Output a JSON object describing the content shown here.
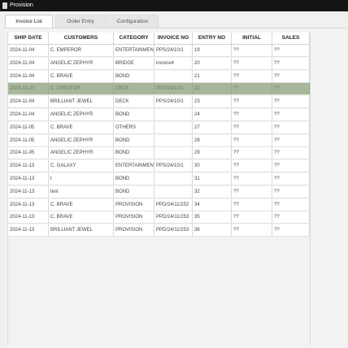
{
  "window": {
    "title": "Provision"
  },
  "tabs": [
    "Invoice List",
    "Order Entry",
    "Configuration"
  ],
  "table": {
    "columns": [
      "SHIP DATE",
      "CUSTOMERS",
      "CATEGORY",
      "INVOICE NO",
      "ENTRY NO",
      "INITIAL",
      "SALES"
    ],
    "rows": [
      [
        "2024-11-04",
        "C. EMPEROR",
        "ENTERTAINMENT",
        "PPS/24/10/1",
        "19",
        "??",
        "??"
      ],
      [
        "2024-11-04",
        "ANGELIC ZEPHYR",
        "BRIDGE",
        "invoice4",
        "20",
        "??",
        "??"
      ],
      [
        "2024-11-04",
        "C. BRAVE",
        "BOND",
        "",
        "21",
        "??",
        "??"
      ],
      [
        "2024-10-20",
        "C. CREATOR",
        "DECK",
        "PPS/24/10/1",
        "22",
        "??",
        "??"
      ],
      [
        "2024-11-04",
        "BRILLIANT JEWEL",
        "DECK",
        "PPS/24/10/1",
        "23",
        "??",
        "??"
      ],
      [
        "2024-11-04",
        "ANGELIC ZEPHYR",
        "BOND",
        "",
        "24",
        "??",
        "??"
      ],
      [
        "2024-11-05",
        "C. BRAVE",
        "OTHERS",
        "",
        "27",
        "??",
        "??"
      ],
      [
        "2024-11-05",
        "ANGELIC ZEPHYR",
        "BOND",
        "",
        "28",
        "??",
        "??"
      ],
      [
        "2024-11-05",
        "ANGELIC ZEPHYR",
        "BOND",
        "",
        "29",
        "??",
        "??"
      ],
      [
        "2024-11-13",
        "C. GALAXY",
        "ENTERTAINMENT",
        "PPS/24/10/1",
        "30",
        "??",
        "??"
      ],
      [
        "2024-11-13",
        "t",
        "BOND",
        "",
        "31",
        "??",
        "??"
      ],
      [
        "2024-11-13",
        "test",
        "BOND",
        "",
        "32",
        "??",
        "??"
      ],
      [
        "2024-11-13",
        "C. BRAVE",
        "PROVISION",
        "PPD/24/11/252",
        "34",
        "??",
        "??"
      ],
      [
        "2024-11-13",
        "C. BRAVE",
        "PROVISION",
        "PPD/24/11/253",
        "35",
        "??",
        "??"
      ],
      [
        "2024-11-13",
        "BRILLIANT JEWEL",
        "PROVISION",
        "PPD/24/11/253",
        "36",
        "??",
        "??"
      ]
    ],
    "selected_row": 3
  },
  "colors": {
    "selected_row": "#a8b79a",
    "titlebar": "#141414"
  }
}
